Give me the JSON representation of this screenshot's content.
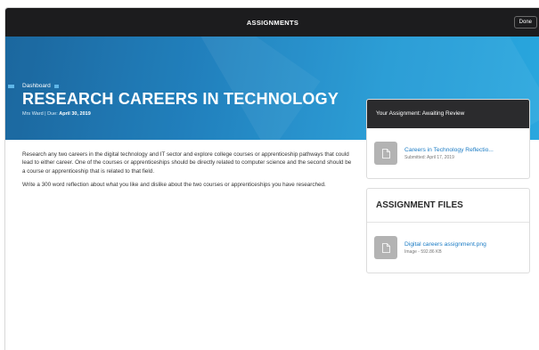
{
  "topbar": {
    "title": "ASSIGNMENTS",
    "done_label": "Done"
  },
  "hero": {
    "breadcrumb": "Dashboard",
    "title": "RESEARCH CAREERS IN TECHNOLOGY",
    "teacher": "Mrs Ward",
    "separator": "|",
    "due_label": "Due:",
    "due_date": "April 30, 2019"
  },
  "description": {
    "paragraphs": [
      "Research any two careers in the digital technology and IT sector and explore college courses or apprenticeship pathways that could lead to either career. One of the courses or apprenticeships should be directly related to computer science and the second should be a course or apprenticeship that is related to that field.",
      "Write a 300 word reflection about what you like and dislike about the two courses or apprenticeships you have researched."
    ]
  },
  "assignment_status": {
    "header": "Your Assignment: Awaiting Review",
    "submission": {
      "name": "Careers in Technology Reflectio...",
      "submitted": "Submitted: April 17, 2019",
      "icon": "document-icon"
    }
  },
  "assignment_files": {
    "header": "ASSIGNMENT FILES",
    "files": [
      {
        "name": "Digital careers assignment.png",
        "meta": "Image - 592.86 KB",
        "icon": "document-icon"
      }
    ]
  },
  "colors": {
    "topbar": "#1c1c1e",
    "hero_start": "#0f5f99",
    "hero_end": "#2aa7de",
    "link": "#1a7bc4",
    "status_header": "#2b2b2d"
  }
}
